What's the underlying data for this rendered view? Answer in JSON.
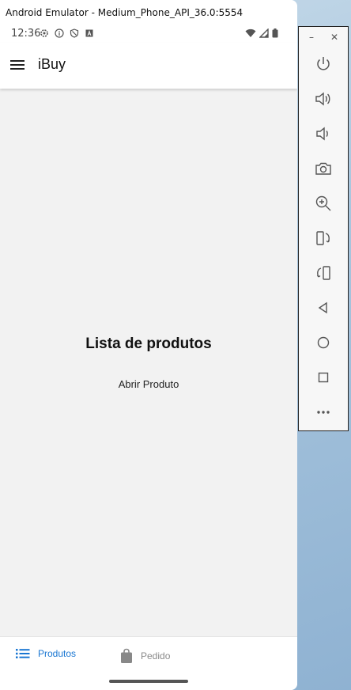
{
  "window": {
    "title": "Android Emulator - Medium_Phone_API_36.0:5554",
    "minimize_glyph": "–",
    "close_glyph": "✕"
  },
  "status_bar": {
    "time": "12:36",
    "left_icons": [
      "settings-icon",
      "info-icon",
      "shield-icon",
      "font-icon"
    ],
    "right_icons": [
      "wifi-icon",
      "signal-icon",
      "battery-icon"
    ]
  },
  "app_bar": {
    "title": "iBuy",
    "menu_icon": "hamburger-menu-icon"
  },
  "content": {
    "title": "Lista de produtos",
    "open_product_label": "Abrir Produto"
  },
  "bottom_nav": {
    "items": [
      {
        "label": "Produtos",
        "icon": "list-icon",
        "active": true
      },
      {
        "label": "Pedido",
        "icon": "shopping-bag-icon",
        "active": false
      }
    ]
  },
  "side_toolbar": {
    "buttons": [
      "power-icon",
      "volume-up-icon",
      "volume-down-icon",
      "camera-icon",
      "zoom-in-icon",
      "rotate-left-icon",
      "rotate-right-icon",
      "back-icon",
      "home-icon",
      "overview-icon",
      "more-icon"
    ]
  },
  "colors": {
    "accent": "#1976d2",
    "screen_background": "#f2f2f2",
    "inactive_nav": "#8a8a8a"
  }
}
